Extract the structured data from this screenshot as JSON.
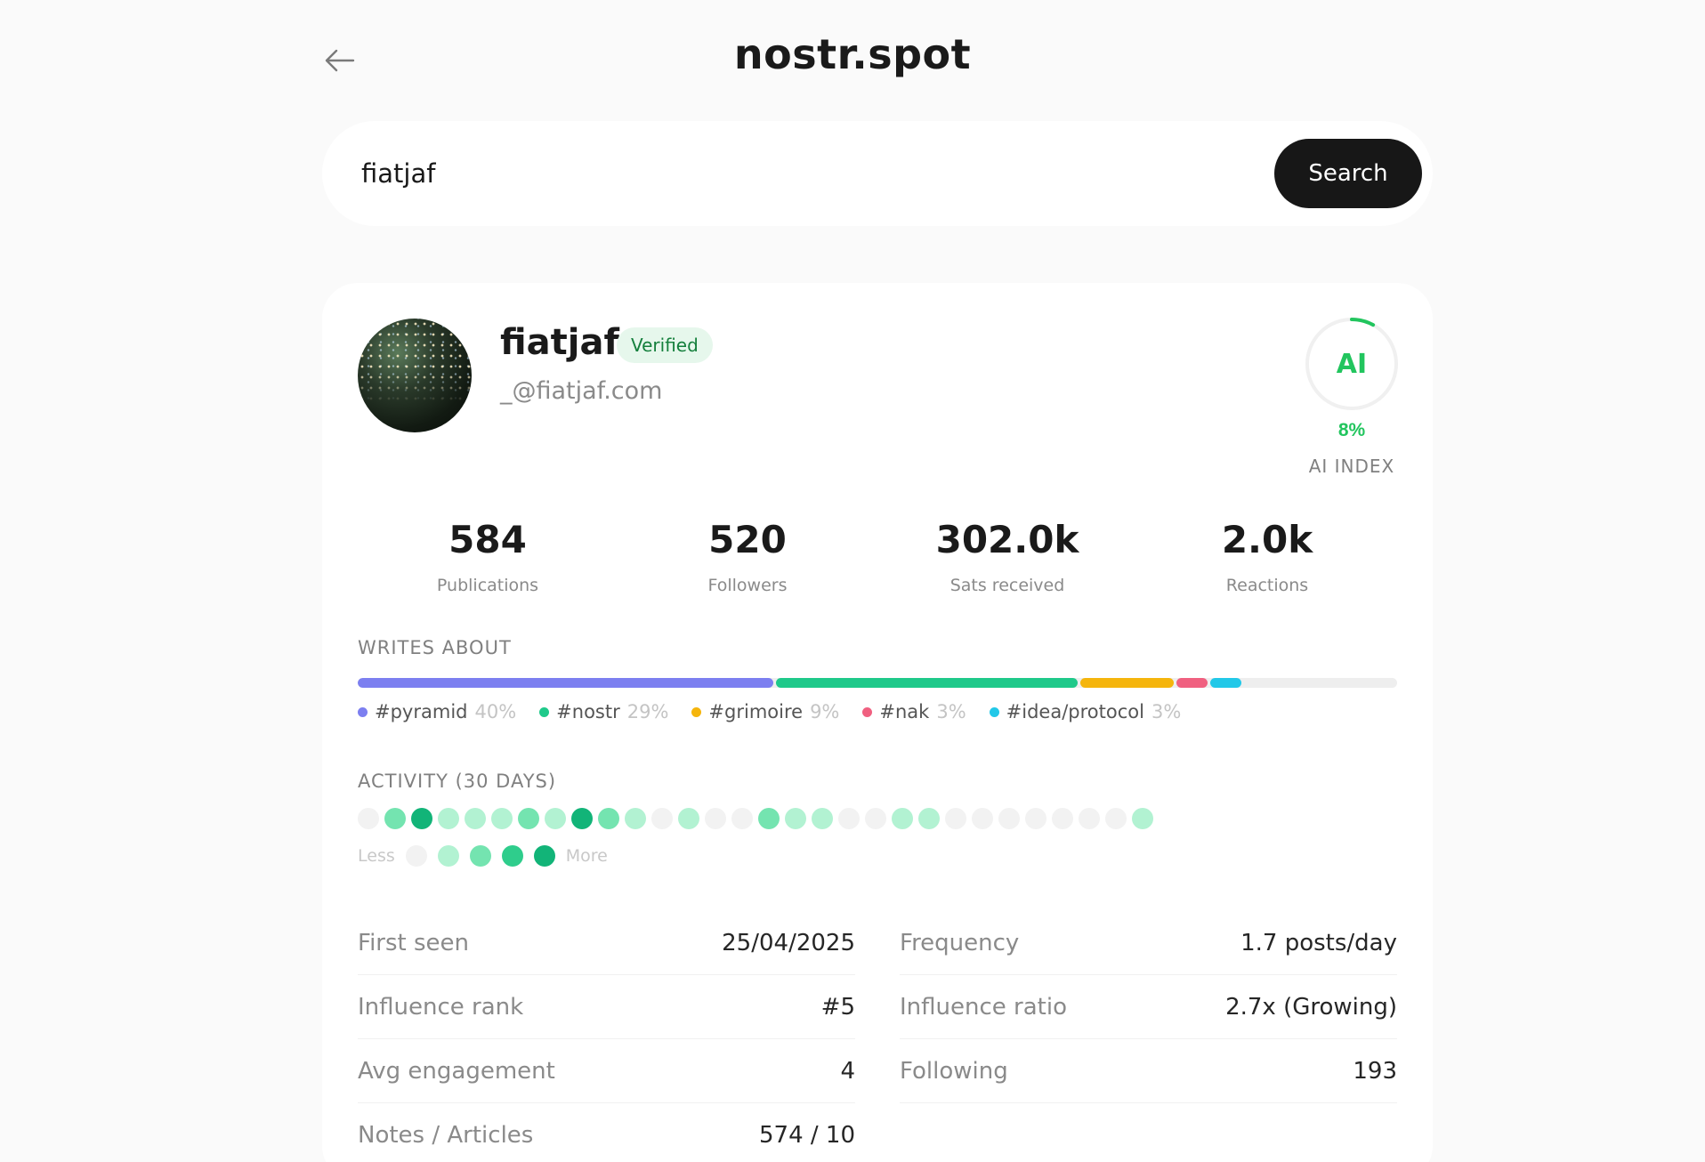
{
  "header": {
    "site_title": "nostr.spot",
    "back_icon": "arrow-left-icon"
  },
  "search": {
    "value": "fiatjaf",
    "button_label": "Search"
  },
  "profile": {
    "name": "fiatjaf",
    "verified_label": "Verified",
    "handle": "_@fiatjaf.com",
    "ai_label": "AI",
    "ai_percent": "8%",
    "ai_fraction": 0.08,
    "ai_caption": "AI INDEX"
  },
  "stats": [
    {
      "value": "584",
      "label": "Publications"
    },
    {
      "value": "520",
      "label": "Followers"
    },
    {
      "value": "302.0k",
      "label": "Sats received"
    },
    {
      "value": "2.0k",
      "label": "Reactions"
    }
  ],
  "writes_about": {
    "title": "WRITES ABOUT",
    "topics": [
      {
        "name": "#pyramid",
        "percent": "40%",
        "value": 40,
        "color": "#7c7ff0"
      },
      {
        "name": "#nostr",
        "percent": "29%",
        "value": 29,
        "color": "#1fc98a"
      },
      {
        "name": "#grimoire",
        "percent": "9%",
        "value": 9,
        "color": "#f5b50c"
      },
      {
        "name": "#nak",
        "percent": "3%",
        "value": 3,
        "color": "#f06080"
      },
      {
        "name": "#idea/protocol",
        "percent": "3%",
        "value": 3,
        "color": "#22c8e8"
      }
    ]
  },
  "activity": {
    "title": "ACTIVITY (30 DAYS)",
    "levels": [
      0,
      2,
      4,
      1,
      1,
      1,
      2,
      1,
      4,
      2,
      1,
      0,
      1,
      0,
      0,
      2,
      1,
      1,
      0,
      0,
      1,
      1,
      0,
      0,
      0,
      0,
      0,
      0,
      0,
      1
    ],
    "level_colors": [
      "#f2f2f2",
      "#b2f2d2",
      "#74e4b0",
      "#2fcd8c",
      "#12b478"
    ],
    "less_label": "Less",
    "more_label": "More"
  },
  "details": {
    "left": [
      {
        "label": "First seen",
        "value": "25/04/2025"
      },
      {
        "label": "Influence rank",
        "value": "#5"
      },
      {
        "label": "Avg engagement",
        "value": "4"
      },
      {
        "label": "Notes / Articles",
        "value": "574 / 10"
      }
    ],
    "right": [
      {
        "label": "Frequency",
        "value": "1.7 posts/day"
      },
      {
        "label": "Influence ratio",
        "value": "2.7x (Growing)"
      },
      {
        "label": "Following",
        "value": "193"
      }
    ]
  }
}
